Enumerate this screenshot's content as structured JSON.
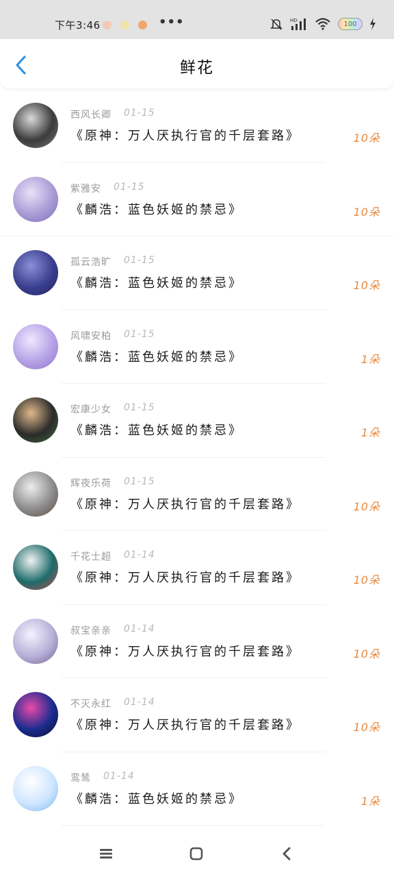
{
  "status_bar": {
    "time": "下午3:46",
    "dots": "•••",
    "battery": "100"
  },
  "header": {
    "title": "鲜花"
  },
  "rows": [
    {
      "name": "西风长卿",
      "date": "01-15",
      "title": "《原神：万人厌执行官的千层套路》",
      "amount": "10朵",
      "avatar": [
        "#3b3b3b",
        "#d9d9d9",
        "#7a7a7a"
      ]
    },
    {
      "name": "紫雅安",
      "date": "01-15",
      "title": "《麟浩：蓝色妖姬的禁忌》",
      "amount": "10朵",
      "avatar": [
        "#a99bd6",
        "#e8e2f7",
        "#7d6fb8"
      ]
    },
    {
      "name": "孤云浩旷",
      "date": "01-15",
      "title": "《麟浩：蓝色妖姬的禁忌》",
      "amount": "10朵",
      "avatar": [
        "#3a3f8f",
        "#8a8fd6",
        "#1f2460"
      ]
    },
    {
      "name": "风啸安柏",
      "date": "01-15",
      "title": "《麟浩：蓝色妖姬的禁忌》",
      "amount": "1朵",
      "avatar": [
        "#b6a2e6",
        "#f0e8ff",
        "#8b74c9"
      ]
    },
    {
      "name": "宏康少女",
      "date": "01-15",
      "title": "《麟浩：蓝色妖姬的禁忌》",
      "amount": "1朵",
      "avatar": [
        "#2b2b2b",
        "#e0b98a",
        "#3d6b3a"
      ]
    },
    {
      "name": "辉夜乐荷",
      "date": "01-15",
      "title": "《原神：万人厌执行官的千层套路》",
      "amount": "10朵",
      "avatar": [
        "#8c8c8c",
        "#eeeeee",
        "#5a4a42"
      ]
    },
    {
      "name": "千花士超",
      "date": "01-14",
      "title": "《原神：万人厌执行官的千层套路》",
      "amount": "10朵",
      "avatar": [
        "#1d6b6b",
        "#f2f2f2",
        "#c94b4b"
      ]
    },
    {
      "name": "叔宝亲亲",
      "date": "01-14",
      "title": "《原神：万人厌执行官的千层套路》",
      "amount": "10朵",
      "avatar": [
        "#b8b0d8",
        "#f5f2ff",
        "#6e6490"
      ]
    },
    {
      "name": "不灭永红",
      "date": "01-14",
      "title": "《原神：万人厌执行官的千层套路》",
      "amount": "10朵",
      "avatar": [
        "#1a2c8f",
        "#e84aa8",
        "#0d0d2a"
      ]
    },
    {
      "name": "鸾鸶",
      "date": "01-14",
      "title": "《麟浩：蓝色妖姬的禁忌》",
      "amount": "1朵",
      "avatar": [
        "#cfe6ff",
        "#ffffff",
        "#7ab8ee"
      ]
    }
  ],
  "colors": {
    "accent_blue": "#2a8fe0",
    "amount_orange": "#e8883c"
  }
}
